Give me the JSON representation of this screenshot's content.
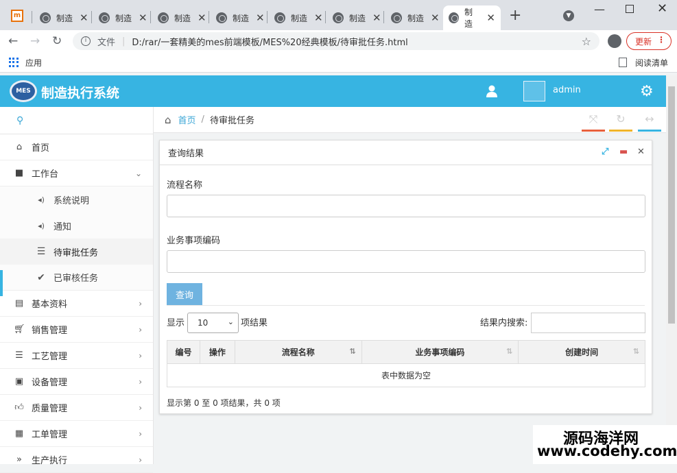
{
  "browser": {
    "tabs": [
      {
        "label": "制造"
      },
      {
        "label": "制造"
      },
      {
        "label": "制造"
      },
      {
        "label": "制造"
      },
      {
        "label": "制造"
      },
      {
        "label": "制造"
      },
      {
        "label": "制造"
      },
      {
        "label": "制造"
      }
    ],
    "url_prefix": "文件",
    "url": "D:/rar/一套精美的mes前端模板/MES%20经典模板/待审批任务.html",
    "update_label": "更新",
    "bookmarks": {
      "apps_label": "应用",
      "reading_list_label": "阅读清单"
    }
  },
  "app": {
    "logo_text": "MES",
    "title": "制造执行系统",
    "username": "admin",
    "accent_color": "#37b4e2"
  },
  "sidebar": {
    "items": [
      {
        "label": "首页",
        "icon": "home-icon"
      },
      {
        "label": "工作台",
        "icon": "comment-icon"
      },
      {
        "label": "基本资料",
        "icon": "list-alt-icon"
      },
      {
        "label": "销售管理",
        "icon": "cart-icon"
      },
      {
        "label": "工艺管理",
        "icon": "list-icon"
      },
      {
        "label": "设备管理",
        "icon": "inbox-icon"
      },
      {
        "label": "质量管理",
        "icon": "thumbs-up-icon"
      },
      {
        "label": "工单管理",
        "icon": "calendar-icon"
      },
      {
        "label": "生产执行",
        "icon": "forward-icon"
      }
    ],
    "sub_items": [
      {
        "label": "系统说明",
        "icon": "volume-icon"
      },
      {
        "label": "通知",
        "icon": "volume-icon"
      },
      {
        "label": "待审批任务",
        "icon": "th-list-icon",
        "active": true
      },
      {
        "label": "已审核任务",
        "icon": "check-icon"
      }
    ]
  },
  "breadcrumb": {
    "home": "首页",
    "current": "待审批任务"
  },
  "panel": {
    "title": "查询结果",
    "fields": [
      {
        "label": "流程名称",
        "value": ""
      },
      {
        "label": "业务事项编码",
        "value": ""
      }
    ],
    "query_button": "查询",
    "table": {
      "show_label": "显示",
      "page_size": "10",
      "after_label": "项结果",
      "search_label": "结果内搜索:",
      "columns": [
        "编号",
        "操作",
        "流程名称",
        "业务事项编码",
        "创建时间"
      ],
      "empty_text": "表中数据为空",
      "info": "显示第 0 至 0 项结果，共 0 项"
    }
  },
  "watermark": {
    "line1": "源码海洋网",
    "line2": "www.codehy.com"
  }
}
